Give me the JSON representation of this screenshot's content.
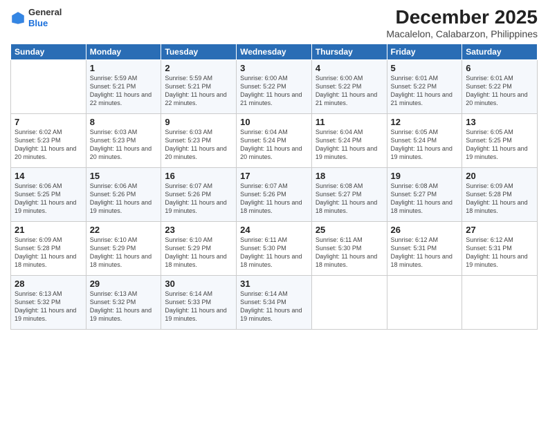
{
  "header": {
    "logo_line1": "General",
    "logo_line2": "Blue",
    "month": "December 2025",
    "location": "Macalelon, Calabarzon, Philippines"
  },
  "days_of_week": [
    "Sunday",
    "Monday",
    "Tuesday",
    "Wednesday",
    "Thursday",
    "Friday",
    "Saturday"
  ],
  "weeks": [
    [
      {
        "day": "",
        "info": ""
      },
      {
        "day": "1",
        "info": "Sunrise: 5:59 AM\nSunset: 5:21 PM\nDaylight: 11 hours\nand 22 minutes."
      },
      {
        "day": "2",
        "info": "Sunrise: 5:59 AM\nSunset: 5:21 PM\nDaylight: 11 hours\nand 22 minutes."
      },
      {
        "day": "3",
        "info": "Sunrise: 6:00 AM\nSunset: 5:22 PM\nDaylight: 11 hours\nand 21 minutes."
      },
      {
        "day": "4",
        "info": "Sunrise: 6:00 AM\nSunset: 5:22 PM\nDaylight: 11 hours\nand 21 minutes."
      },
      {
        "day": "5",
        "info": "Sunrise: 6:01 AM\nSunset: 5:22 PM\nDaylight: 11 hours\nand 21 minutes."
      },
      {
        "day": "6",
        "info": "Sunrise: 6:01 AM\nSunset: 5:22 PM\nDaylight: 11 hours\nand 20 minutes."
      }
    ],
    [
      {
        "day": "7",
        "info": "Sunrise: 6:02 AM\nSunset: 5:23 PM\nDaylight: 11 hours\nand 20 minutes."
      },
      {
        "day": "8",
        "info": "Sunrise: 6:03 AM\nSunset: 5:23 PM\nDaylight: 11 hours\nand 20 minutes."
      },
      {
        "day": "9",
        "info": "Sunrise: 6:03 AM\nSunset: 5:23 PM\nDaylight: 11 hours\nand 20 minutes."
      },
      {
        "day": "10",
        "info": "Sunrise: 6:04 AM\nSunset: 5:24 PM\nDaylight: 11 hours\nand 20 minutes."
      },
      {
        "day": "11",
        "info": "Sunrise: 6:04 AM\nSunset: 5:24 PM\nDaylight: 11 hours\nand 19 minutes."
      },
      {
        "day": "12",
        "info": "Sunrise: 6:05 AM\nSunset: 5:24 PM\nDaylight: 11 hours\nand 19 minutes."
      },
      {
        "day": "13",
        "info": "Sunrise: 6:05 AM\nSunset: 5:25 PM\nDaylight: 11 hours\nand 19 minutes."
      }
    ],
    [
      {
        "day": "14",
        "info": "Sunrise: 6:06 AM\nSunset: 5:25 PM\nDaylight: 11 hours\nand 19 minutes."
      },
      {
        "day": "15",
        "info": "Sunrise: 6:06 AM\nSunset: 5:26 PM\nDaylight: 11 hours\nand 19 minutes."
      },
      {
        "day": "16",
        "info": "Sunrise: 6:07 AM\nSunset: 5:26 PM\nDaylight: 11 hours\nand 19 minutes."
      },
      {
        "day": "17",
        "info": "Sunrise: 6:07 AM\nSunset: 5:26 PM\nDaylight: 11 hours\nand 18 minutes."
      },
      {
        "day": "18",
        "info": "Sunrise: 6:08 AM\nSunset: 5:27 PM\nDaylight: 11 hours\nand 18 minutes."
      },
      {
        "day": "19",
        "info": "Sunrise: 6:08 AM\nSunset: 5:27 PM\nDaylight: 11 hours\nand 18 minutes."
      },
      {
        "day": "20",
        "info": "Sunrise: 6:09 AM\nSunset: 5:28 PM\nDaylight: 11 hours\nand 18 minutes."
      }
    ],
    [
      {
        "day": "21",
        "info": "Sunrise: 6:09 AM\nSunset: 5:28 PM\nDaylight: 11 hours\nand 18 minutes."
      },
      {
        "day": "22",
        "info": "Sunrise: 6:10 AM\nSunset: 5:29 PM\nDaylight: 11 hours\nand 18 minutes."
      },
      {
        "day": "23",
        "info": "Sunrise: 6:10 AM\nSunset: 5:29 PM\nDaylight: 11 hours\nand 18 minutes."
      },
      {
        "day": "24",
        "info": "Sunrise: 6:11 AM\nSunset: 5:30 PM\nDaylight: 11 hours\nand 18 minutes."
      },
      {
        "day": "25",
        "info": "Sunrise: 6:11 AM\nSunset: 5:30 PM\nDaylight: 11 hours\nand 18 minutes."
      },
      {
        "day": "26",
        "info": "Sunrise: 6:12 AM\nSunset: 5:31 PM\nDaylight: 11 hours\nand 18 minutes."
      },
      {
        "day": "27",
        "info": "Sunrise: 6:12 AM\nSunset: 5:31 PM\nDaylight: 11 hours\nand 19 minutes."
      }
    ],
    [
      {
        "day": "28",
        "info": "Sunrise: 6:13 AM\nSunset: 5:32 PM\nDaylight: 11 hours\nand 19 minutes."
      },
      {
        "day": "29",
        "info": "Sunrise: 6:13 AM\nSunset: 5:32 PM\nDaylight: 11 hours\nand 19 minutes."
      },
      {
        "day": "30",
        "info": "Sunrise: 6:14 AM\nSunset: 5:33 PM\nDaylight: 11 hours\nand 19 minutes."
      },
      {
        "day": "31",
        "info": "Sunrise: 6:14 AM\nSunset: 5:34 PM\nDaylight: 11 hours\nand 19 minutes."
      },
      {
        "day": "",
        "info": ""
      },
      {
        "day": "",
        "info": ""
      },
      {
        "day": "",
        "info": ""
      }
    ]
  ]
}
